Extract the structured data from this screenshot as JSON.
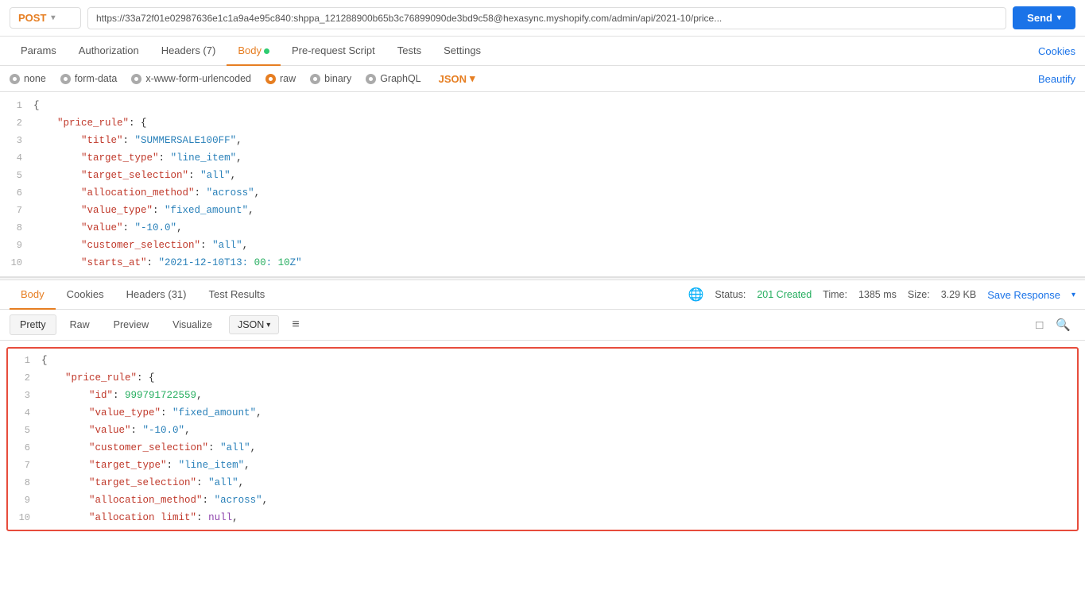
{
  "topbar": {
    "method": "POST",
    "url": "https://33a72f01e02987636e1c1a9a4e95c840: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@hexasync.myshopify.com/admin/api/2021-10/price...",
    "send_label": "Send"
  },
  "req_tabs": {
    "tabs": [
      {
        "id": "params",
        "label": "Params",
        "active": false
      },
      {
        "id": "authorization",
        "label": "Authorization",
        "active": false
      },
      {
        "id": "headers",
        "label": "Headers (7)",
        "active": false
      },
      {
        "id": "body",
        "label": "Body",
        "active": true,
        "dot": true
      },
      {
        "id": "prerequest",
        "label": "Pre-request Script",
        "active": false
      },
      {
        "id": "tests",
        "label": "Tests",
        "active": false
      },
      {
        "id": "settings",
        "label": "Settings",
        "active": false
      }
    ],
    "cookies_link": "Cookies"
  },
  "body_types": [
    {
      "id": "none",
      "label": "none",
      "checked": false
    },
    {
      "id": "form-data",
      "label": "form-data",
      "checked": false
    },
    {
      "id": "urlencoded",
      "label": "x-www-form-urlencoded",
      "checked": false
    },
    {
      "id": "raw",
      "label": "raw",
      "checked": true,
      "orange": true
    },
    {
      "id": "binary",
      "label": "binary",
      "checked": false
    },
    {
      "id": "graphql",
      "label": "GraphQL",
      "checked": false
    }
  ],
  "json_dropdown_label": "JSON",
  "beautify_label": "Beautify",
  "req_code_lines": [
    {
      "num": 1,
      "content": "{"
    },
    {
      "num": 2,
      "content": "    \"price_rule\": {"
    },
    {
      "num": 3,
      "content": "        \"title\": \"SUMMERSALE100FF\","
    },
    {
      "num": 4,
      "content": "        \"target_type\": \"line_item\","
    },
    {
      "num": 5,
      "content": "        \"target_selection\": \"all\","
    },
    {
      "num": 6,
      "content": "        \"allocation_method\": \"across\","
    },
    {
      "num": 7,
      "content": "        \"value_type\": \"fixed_amount\","
    },
    {
      "num": 8,
      "content": "        \"value\": \"-10.0\","
    },
    {
      "num": 9,
      "content": "        \"customer_selection\": \"all\","
    },
    {
      "num": 10,
      "content": "        \"starts_at\": \"2021-12-10T13:00:10Z\""
    }
  ],
  "resp_tabs": {
    "tabs": [
      {
        "id": "body",
        "label": "Body",
        "active": true
      },
      {
        "id": "cookies",
        "label": "Cookies",
        "active": false
      },
      {
        "id": "headers",
        "label": "Headers (31)",
        "active": false
      },
      {
        "id": "test_results",
        "label": "Test Results",
        "active": false
      }
    ]
  },
  "resp_stats": {
    "status_label": "Status:",
    "status_value": "201 Created",
    "time_label": "Time:",
    "time_value": "1385 ms",
    "size_label": "Size:",
    "size_value": "3.29 KB",
    "save_response": "Save Response"
  },
  "resp_view": {
    "buttons": [
      {
        "id": "pretty",
        "label": "Pretty",
        "active": true
      },
      {
        "id": "raw",
        "label": "Raw",
        "active": false
      },
      {
        "id": "preview",
        "label": "Preview",
        "active": false
      },
      {
        "id": "visualize",
        "label": "Visualize",
        "active": false
      }
    ],
    "json_label": "JSON"
  },
  "resp_code_lines": [
    {
      "num": 1,
      "content": "{"
    },
    {
      "num": 2,
      "content": "    \"price_rule\": {"
    },
    {
      "num": 3,
      "content": "        \"id\": 999791722559,"
    },
    {
      "num": 4,
      "content": "        \"value_type\": \"fixed_amount\","
    },
    {
      "num": 5,
      "content": "        \"value\": \"-10.0\","
    },
    {
      "num": 6,
      "content": "        \"customer_selection\": \"all\","
    },
    {
      "num": 7,
      "content": "        \"target_type\": \"line_item\","
    },
    {
      "num": 8,
      "content": "        \"target_selection\": \"all\","
    },
    {
      "num": 9,
      "content": "        \"allocation_method\": \"across\","
    },
    {
      "num": 10,
      "content": "        \"allocation limit\": null,"
    }
  ]
}
